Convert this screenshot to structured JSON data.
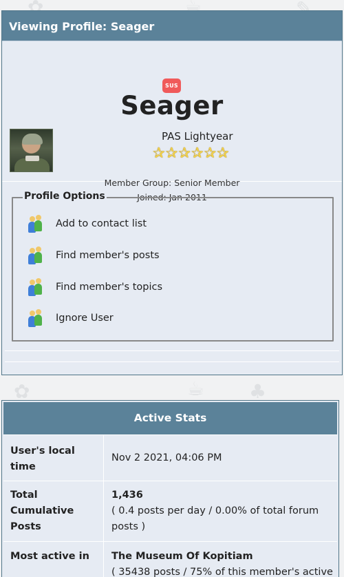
{
  "profile": {
    "header": "Viewing Profile: Seager",
    "badge": "SUS",
    "username": "Seager",
    "title": "PAS Lightyear",
    "stars": 6,
    "member_group": "Member Group: Senior Member",
    "joined": "Joined: Jan 2011",
    "avatar_icon": "avatar-image"
  },
  "options": {
    "legend": "Profile Options",
    "items": [
      {
        "label": "Add to contact list",
        "icon": "people-icon"
      },
      {
        "label": "Find member's posts",
        "icon": "people-icon"
      },
      {
        "label": "Find member's topics",
        "icon": "people-icon"
      },
      {
        "label": "Ignore User",
        "icon": "people-icon"
      }
    ]
  },
  "stats": {
    "header": "Active Stats",
    "rows": [
      {
        "label": "User's local time",
        "value": "Nov 2 2021, 04:06 PM"
      },
      {
        "label": "Total Cumulative Posts",
        "value_main": "1,436",
        "value_sub": "( 0.4 posts per day / 0.00% of total forum posts )"
      },
      {
        "label": "Most active in",
        "value_main": "The Museum Of Kopitiam",
        "value_sub": "( 35438 posts / 75% of this member's active"
      }
    ]
  },
  "colors": {
    "header_bg": "#5b8299",
    "panel_bg": "#e6ebf3",
    "badge_bg": "#f05a5a",
    "star": "#f7d54a"
  }
}
